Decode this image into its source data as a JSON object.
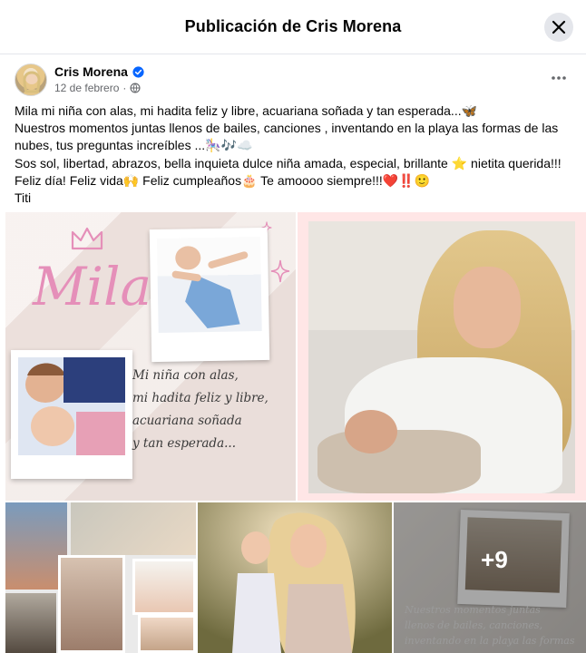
{
  "modal": {
    "title": "Publicación de Cris Morena",
    "close_label": "×"
  },
  "post": {
    "author": "Cris Morena",
    "date": "12 de febrero",
    "dot": "·",
    "more_label": "···",
    "verified_icon": "verified-badge-icon",
    "audience_icon": "globe-icon",
    "text_lines": [
      "Mila mi niña con alas, mi hadita feliz  y libre, acuariana soñada y tan esperada...🦋",
      "Nuestros momentos juntas llenos de bailes, canciones , inventando en la playa las formas de las",
      "nubes, tus preguntas increíbles ...🎠🎶☁️",
      "Sos sol, libertad, abrazos, bella inquieta dulce niña amada, especial, brillante ⭐ nietita querida!!!",
      "Feliz día! Feliz vida🙌 Feliz cumpleaños🎂 Te amoooo siempre!!!❤️‼️🙂",
      "Titi"
    ]
  },
  "media": {
    "tile1_name": "Mila",
    "tile1_script": [
      "Mi niña con alas,",
      "mi hadita feliz y libre,",
      "acuariana soñada",
      "y tan esperada..."
    ],
    "tile5_script": [
      "Nuestros momentos juntas",
      "llenos de bailes, canciones,",
      "inventando en la playa las formas"
    ],
    "more_count": "+9"
  },
  "colors": {
    "accent_blue": "#0866ff",
    "title_text": "#050505",
    "meta_text": "#65676b",
    "pink": "#e58fb9"
  }
}
